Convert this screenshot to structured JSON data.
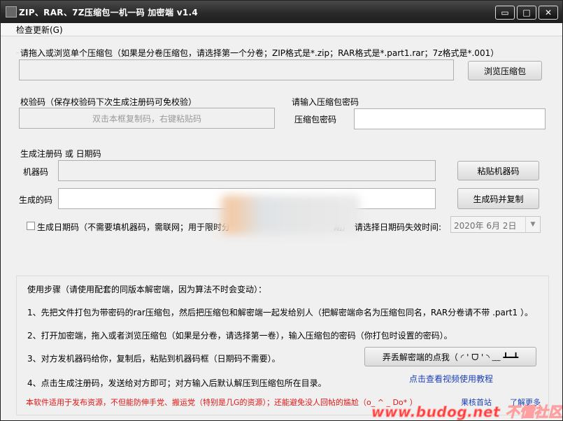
{
  "window": {
    "title": "ZIP、RAR、7Z压缩包一机一码  加密端 v1.4",
    "controls": {
      "minimize": "▭",
      "maximize": "□",
      "close": "✕"
    }
  },
  "menu": {
    "check_update": "检查更新(G)"
  },
  "file_section": {
    "instructions": "请拖入或浏览单个压缩包（如果是分卷压缩包，请选择第一个分卷；ZIP格式是*.zip；RAR格式是*.part1.rar；7z格式是*.001）",
    "path_value": "",
    "browse_button": "浏览压缩包"
  },
  "verify_section": {
    "label": "校验码（保存校验码下次生成注册码可免校验）",
    "placeholder": "双击本框复制码，右键粘贴码"
  },
  "password_section": {
    "label": "请输入压缩包密码",
    "field_label": "压缩包密码",
    "value": ""
  },
  "generate_section": {
    "label": "生成注册码 或 日期码",
    "machine_code_label": "机器码",
    "machine_code_value": "",
    "paste_button": "粘贴机器码",
    "generated_label": "生成的码",
    "generated_value": "",
    "generate_button": "生成码并复制",
    "date_checkbox_label": "生成日期码（不需要填机器码，需联网；用于限时分",
    "date_checkbox_tail": "期）",
    "date_prompt": "请选择日期码失效时间:",
    "date_value": "2020年  6月  2日"
  },
  "help_panel": {
    "heading": "使用步骤（请使用配套的同版本解密端，因为算法不时会变动）：",
    "step1": "1、先把文件打包为带密码的rar压缩包，然后把压缩包和解密端一起发给别人（把解密端命名为压缩包同名，RAR分卷请不带 .part1 ）。",
    "step2": "2、打开加密端，拖入或者浏览压缩包（如果是分卷，请选择第一卷），输入压缩包的密码（你打包时设置的密码）。",
    "step3": "3、对方发机器码给你，复制后，粘贴到机器码框（日期码不需要）。",
    "step4": "4、点击生成注册码，发送给对方即可；对方输入后默认解压到压缩包所在目录。",
    "fun_button": "弄丢解密端的点我（ ◜ ' ᗜ ' ◝ ﹏ ┻━┻",
    "video_link": "点击查看视频使用教程",
    "notice": "本软件适用于发布资源，不但能防伸手党、搬运党（特别是几G的资源）；还能避免没人回帖的尴尬（o_ ^ _ Do* ）",
    "footer_link1": "果核首站",
    "footer_link2": "了解更多"
  },
  "watermark": "www.budog.net 不懂社区"
}
